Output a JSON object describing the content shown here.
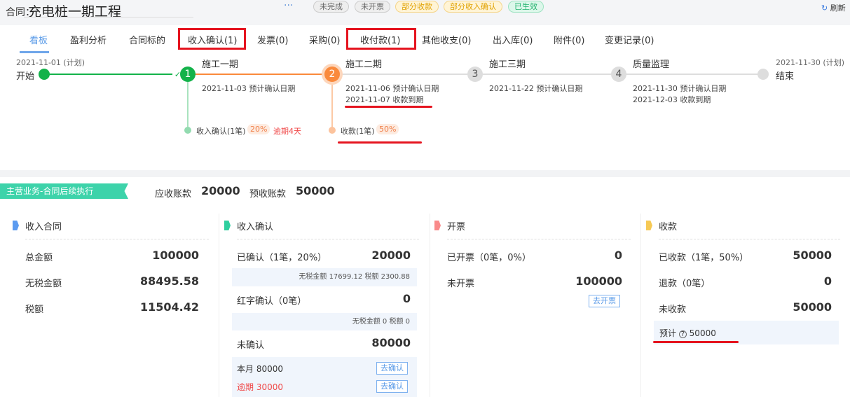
{
  "header": {
    "label": "合同：",
    "title": "充电桩一期工程",
    "more": "···",
    "refresh": "刷新",
    "badges": [
      {
        "text": "未完成",
        "bg": "#eee",
        "bd": "#ccc",
        "fg": "#666"
      },
      {
        "text": "未开票",
        "bg": "#eee",
        "bd": "#ccc",
        "fg": "#666"
      },
      {
        "text": "部分收款",
        "bg": "#fff4d6",
        "bd": "#f5d58a",
        "fg": "#e0a100"
      },
      {
        "text": "部分收入确认",
        "bg": "#fff4d6",
        "bd": "#f5d58a",
        "fg": "#e0a100"
      },
      {
        "text": "已生效",
        "bg": "#dcf7ea",
        "bd": "#9ee3c2",
        "fg": "#20b26c"
      }
    ]
  },
  "tabs": [
    "看板",
    "盈利分析",
    "合同标的",
    "收入确认(1)",
    "发票(0)",
    "采购(0)",
    "收付款(1)",
    "其他收支(0)",
    "出入库(0)",
    "附件(0)",
    "变更记录(0)"
  ],
  "timeline": {
    "start": {
      "date": "2021-11-01 (计划)",
      "label": "开始"
    },
    "end": {
      "date": "2021-11-30 (计划)",
      "label": "结束"
    },
    "nodes": [
      {
        "num": "1",
        "name": "施工一期",
        "lines": [
          "2021-11-03 预计确认日期"
        ]
      },
      {
        "num": "2",
        "name": "施工二期",
        "lines": [
          "2021-11-06 预计确认日期",
          "2021-11-07 收款到期"
        ]
      },
      {
        "num": "3",
        "name": "施工三期",
        "lines": [
          "2021-11-22 预计确认日期"
        ]
      },
      {
        "num": "4",
        "name": "质量监理",
        "lines": [
          "2021-11-30 预计确认日期",
          "2021-12-03 收款到期"
        ]
      }
    ],
    "branch1": {
      "label": "收入确认(1笔)",
      "pct": "20%",
      "overdue": "逾期4天"
    },
    "branch2": {
      "label": "收款(1笔)",
      "pct": "50%"
    }
  },
  "section": {
    "banner": "主营业务-合同后续执行",
    "ar_label": "应收账款",
    "ar": "20000",
    "pre_label": "预收账款",
    "pre": "50000"
  },
  "cards": {
    "contract": {
      "title": "收入合同",
      "rows": [
        [
          "总金额",
          "100000"
        ],
        [
          "无税金额",
          "88495.58"
        ],
        [
          "税额",
          "11504.42"
        ]
      ]
    },
    "confirm": {
      "title": "收入确认",
      "r1": [
        "已确认（1笔，20%）",
        "20000"
      ],
      "s1": "无税金额 17699.12 税额 2300.88",
      "r2": [
        "红字确认（0笔）",
        "0"
      ],
      "s2": "无税金额 0 税额 0",
      "r3": [
        "未确认",
        "80000"
      ],
      "month": "本月 80000",
      "overdue": "逾期 30000",
      "btn": "去确认"
    },
    "invoice": {
      "title": "开票",
      "r1": [
        "已开票（0笔，0%）",
        "0"
      ],
      "r2": [
        "未开票",
        "100000"
      ],
      "btn": "去开票"
    },
    "collect": {
      "title": "收款",
      "r1": [
        "已收款（1笔，50%）",
        "50000"
      ],
      "r2": [
        "退款（0笔）",
        "0"
      ],
      "r3": [
        "未收款",
        "50000"
      ],
      "est": "预计",
      "est_val": "50000"
    }
  }
}
